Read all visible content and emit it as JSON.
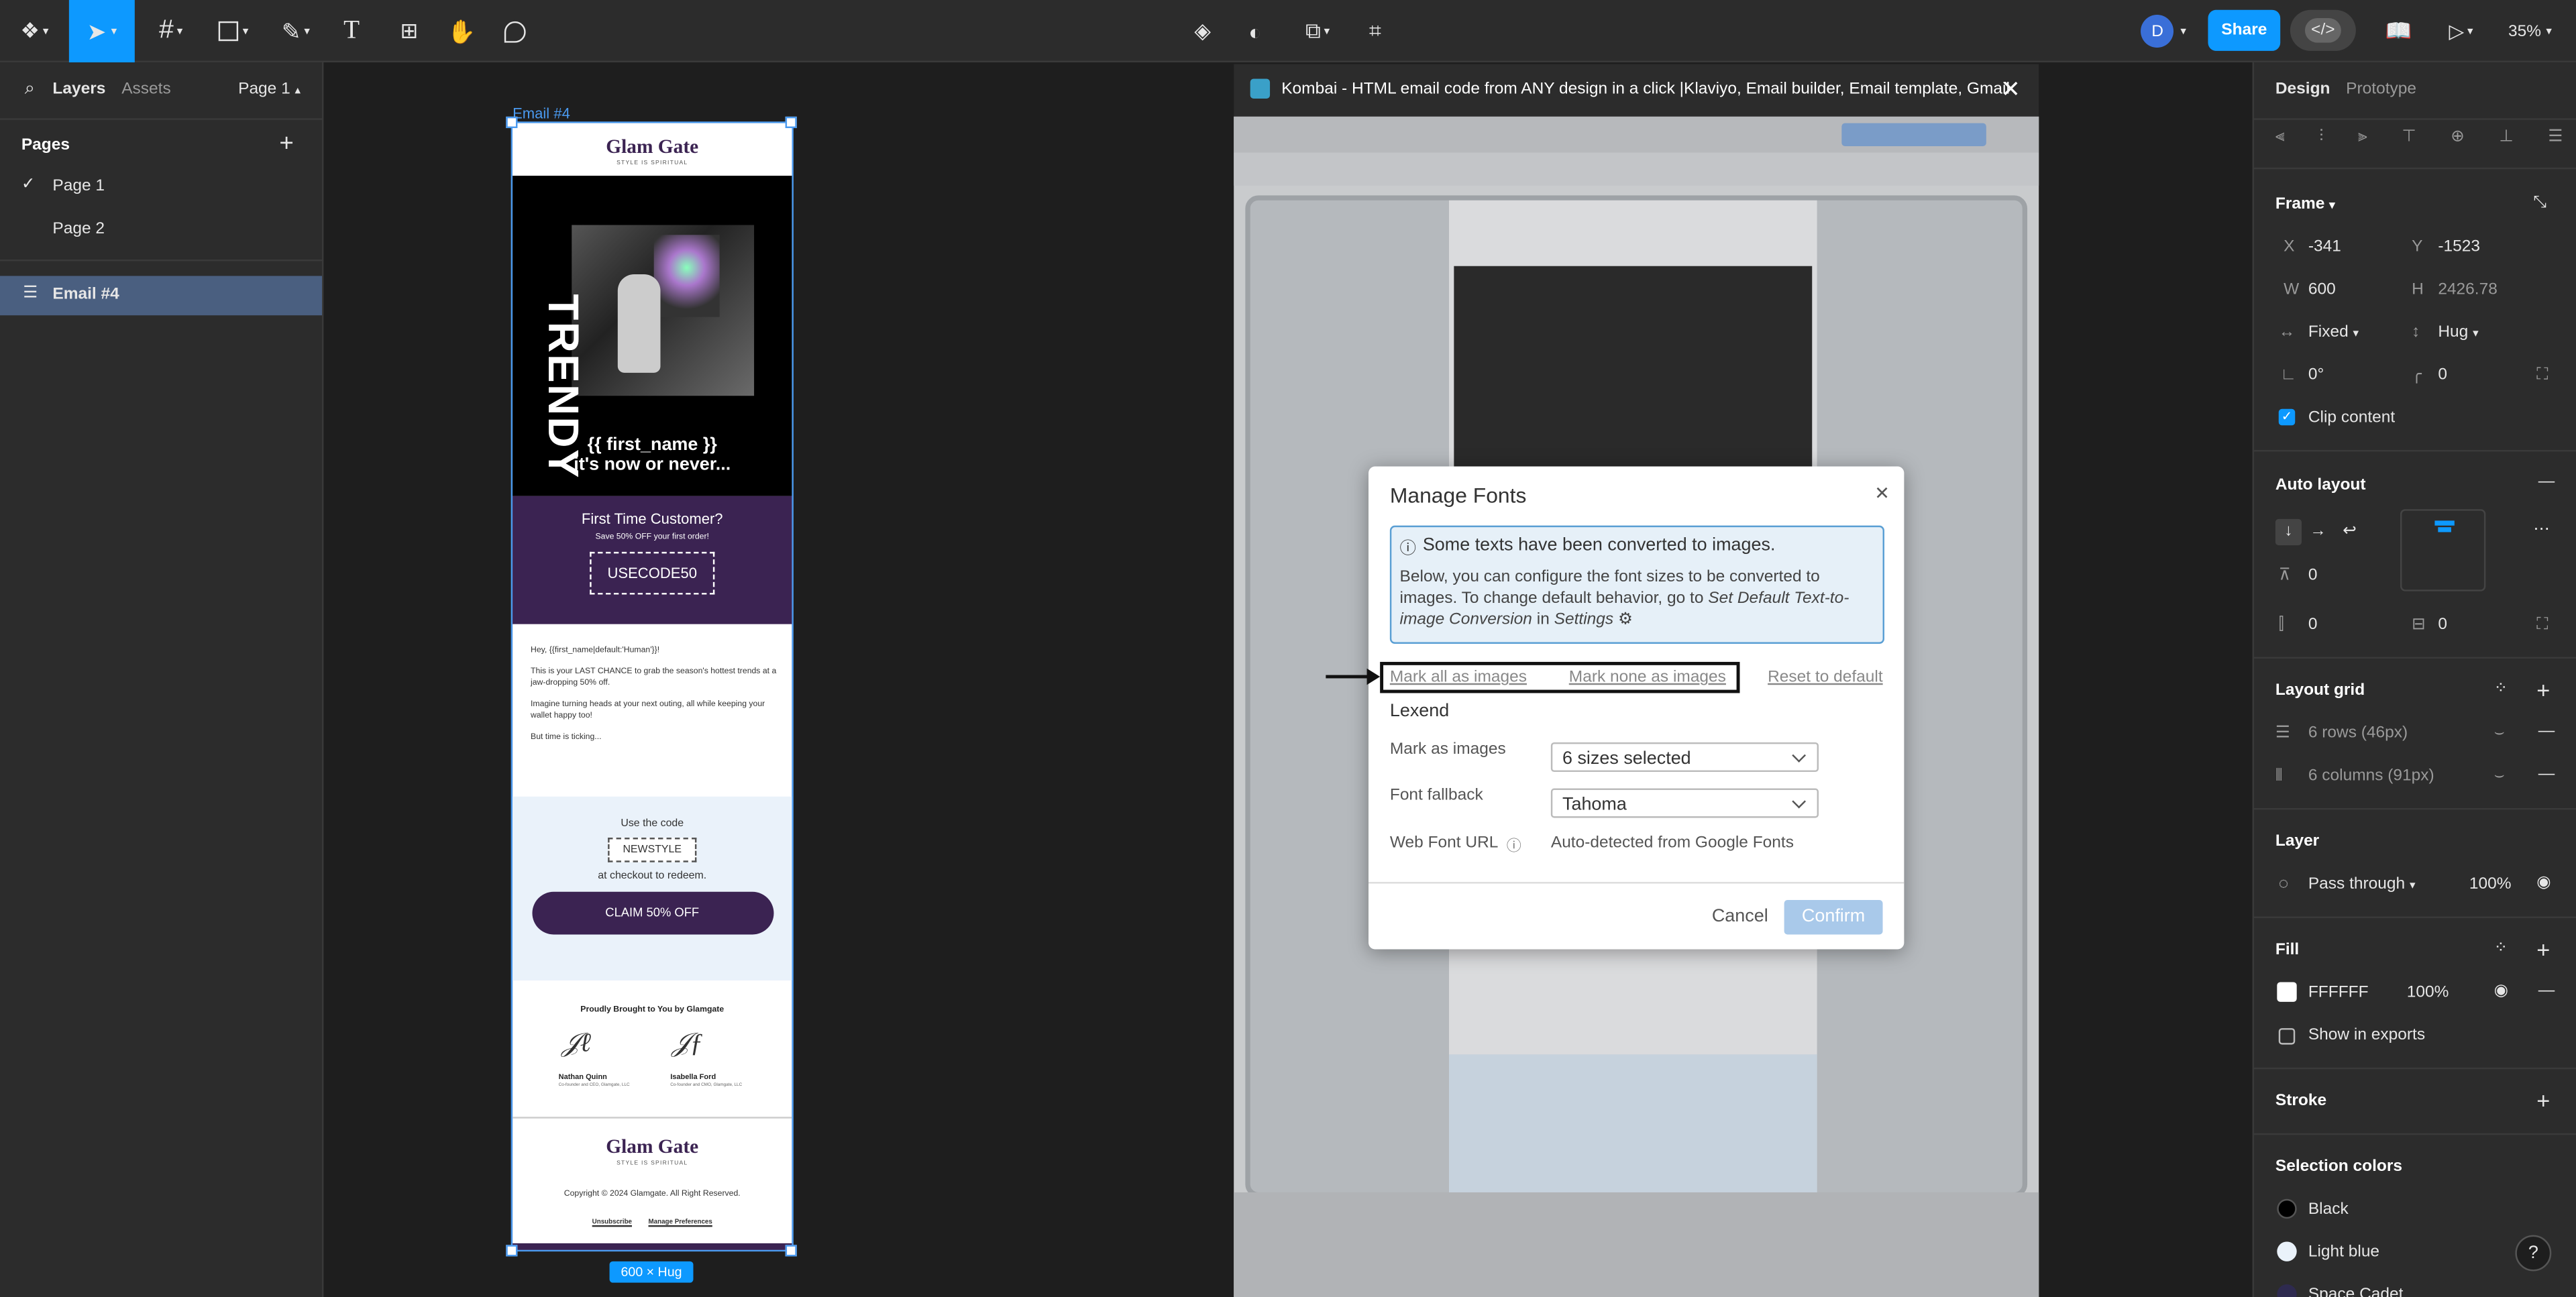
{
  "toolbar": {
    "share": "Share",
    "zoom": "35%",
    "avatar": "D"
  },
  "left": {
    "tabs": [
      "Layers",
      "Assets"
    ],
    "page_selector": "Page 1",
    "pages_title": "Pages",
    "pages": [
      "Page 1",
      "Page 2"
    ],
    "layer": "Email #4"
  },
  "canvas": {
    "frame_label": "Email #4",
    "size_badge": "600 × Hug"
  },
  "email": {
    "brand": "Glam Gate",
    "tagline": "STYLE IS SPIRITUAL",
    "hero_word": "TRENDY",
    "hero_line1": "{{ first_name }}",
    "hero_line2": "it's now or never...",
    "offer_title": "First Time Customer?",
    "offer_sub": "Save 50% OFF your first order!",
    "offer_code": "USECODE50",
    "greeting": "Hey, {{first_name|default:'Human'}}!",
    "p1": "This is your LAST CHANCE to grab the season's hottest trends at a jaw-dropping 50% off.",
    "p2": "Imagine turning heads at your next outing, all while keeping your wallet happy too!",
    "p3": "But time is ticking...",
    "use_code": "Use the code",
    "code2": "NEWSTYLE",
    "redeem": "at checkout to redeem.",
    "cta": "CLAIM 50% OFF",
    "brought": "Proudly Brought to You by Glamgate",
    "sig1_name": "Nathan Quinn",
    "sig1_role": "Co-founder and CEO, Glamgate, LLC",
    "sig2_name": "Isabella Ford",
    "sig2_role": "Co-founder and CMO, Glamgate, LLC",
    "copyright": "Copyright © 2024 Glamgate. All Right Reserved.",
    "unsub": "Unsubscribe",
    "manage": "Manage Preferences"
  },
  "plugin": {
    "title": "Kombai - HTML email code from ANY design in a click |Klaviyo, Email builder, Email template, Gmail"
  },
  "modal": {
    "title": "Manage Fonts",
    "info_head": "Some texts have been converted to images.",
    "info_body": "Below, you can configure the font sizes to be converted to images. To change default behavior, go to ",
    "info_link": "Set Default Text-to-image Conversion",
    "info_in": " in ",
    "info_settings": "Settings",
    "mark_all": "Mark all as images",
    "mark_none": "Mark none as images",
    "reset": "Reset to default",
    "font": "Lexend",
    "row1_label": "Mark as images",
    "row1_value": "6 sizes selected",
    "row2_label": "Font fallback",
    "row2_value": "Tahoma",
    "row3_label": "Web Font URL",
    "row3_value": "Auto-detected from Google Fonts",
    "cancel": "Cancel",
    "confirm": "Confirm"
  },
  "right": {
    "tabs": [
      "Design",
      "Prototype"
    ],
    "frame": "Frame",
    "x": "-341",
    "y": "-1523",
    "w": "600",
    "h": "2426.78",
    "wlabel": "Fixed",
    "hlabel": "Hug",
    "rot": "0°",
    "radius": "0",
    "clip": "Clip content",
    "auto_layout": "Auto layout",
    "gap": "0",
    "pad_h": "0",
    "pad_v": "0",
    "layout_grid": "Layout grid",
    "rows": "6 rows (46px)",
    "cols": "6 columns (91px)",
    "layer": "Layer",
    "blend": "Pass through",
    "opacity": "100%",
    "fill": "Fill",
    "fill_hex": "FFFFFF",
    "fill_op": "100%",
    "show_exports": "Show in exports",
    "stroke": "Stroke",
    "sel_colors": "Selection colors",
    "colors": [
      "Black",
      "Light blue",
      "Space Cadet"
    ]
  },
  "colors": {
    "accent": "#0d99ff",
    "purple": "#3b2352",
    "light_blue": "#eaf2fa"
  }
}
